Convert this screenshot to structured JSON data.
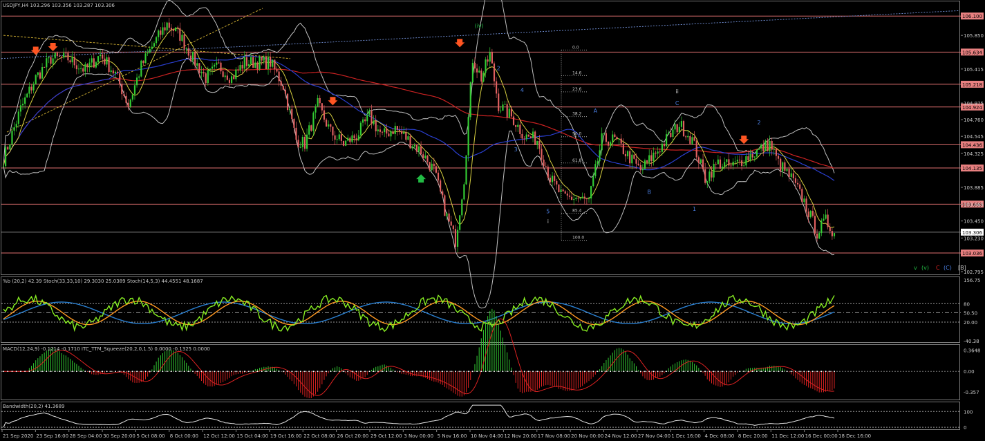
{
  "window": {
    "main_header": "USDJPY,H4  103.296 103.356 103.287 103.306",
    "osc_header": "%b (20,2) 42.39   Stoch(33,33,10) 29.3030 25.0389   Stoch(14,5,3) 44.4551 48.1687",
    "macd_header": "MACD(12,24,9) -0.1214 -0.1710   ITC_TTM_Squeeze(20,2,0,1.5) 0.0000 -0.1325 0.0000",
    "bw_header": "Bandwidth(20,2) 41.3689"
  },
  "colors": {
    "background": "#000000",
    "level_line": "#e07070",
    "bull_candle": "#33cc33",
    "bear_candle": "#e06060",
    "ma_red": "#cc2222",
    "ma_blue": "#2a3fd0",
    "ma_yellow": "#d8d040",
    "bands": "#c0c0c0",
    "arrow_down": "#ff5522",
    "arrow_up": "#22bb44",
    "fib": "#a0a0a0",
    "stoch_orange": "#ff9922",
    "stoch_lime": "#88ee22",
    "pb_blue": "#2a7fd0",
    "macd_pos": "#33cc33",
    "macd_neg": "#dd2222",
    "macd_signal": "#dd2222"
  },
  "chart_data": {
    "type": "line",
    "symbol": "USDJPY",
    "timeframe": "H4",
    "price_axis": {
      "min": 102.795,
      "max": 106.2,
      "ticks": [
        "105.850",
        "105.415",
        "104.975",
        "104.760",
        "104.545",
        "104.325",
        "103.885",
        "103.665",
        "103.450",
        "103.230",
        "102.795"
      ],
      "tick_values": [
        105.85,
        105.415,
        104.975,
        104.76,
        104.545,
        104.325,
        103.885,
        103.665,
        103.45,
        103.23,
        102.795
      ]
    },
    "levels": [
      {
        "label": "106.100",
        "value": 106.1
      },
      {
        "label": "105.634",
        "value": 105.634
      },
      {
        "label": "105.218",
        "value": 105.218
      },
      {
        "label": "104.924",
        "value": 104.924
      },
      {
        "label": "104.436",
        "value": 104.436
      },
      {
        "label": "104.135",
        "value": 104.135
      },
      {
        "label": "103.668",
        "value": 103.668
      },
      {
        "label": "103.036",
        "value": 103.036
      }
    ],
    "current_price": {
      "label": "103.306",
      "value": 103.306
    },
    "time_labels": [
      "21 Sep 2020",
      "23 Sep 16:00",
      "28 Sep 04:00",
      "30 Sep 20:00",
      "5 Oct 08:00",
      "8 Oct 00:00",
      "12 Oct 12:00",
      "15 Oct 04:00",
      "19 Oct 16:00",
      "22 Oct 08:00",
      "26 Oct 20:00",
      "29 Oct 12:00",
      "3 Nov 00:00",
      "5 Nov 16:00",
      "10 Nov 04:00",
      "12 Nov 20:00",
      "17 Nov 08:00",
      "20 Nov 00:00",
      "24 Nov 12:00",
      "27 Nov 04:00",
      "1 Dec 16:00",
      "4 Dec 08:00",
      "8 Dec 20:00",
      "11 Dec 12:00",
      "16 Dec 00:00",
      "18 Dec 16:00"
    ],
    "close_path": [
      [
        0,
        104.25
      ],
      [
        8,
        104.9
      ],
      [
        15,
        105.3
      ],
      [
        22,
        105.55
      ],
      [
        30,
        105.55
      ],
      [
        38,
        105.4
      ],
      [
        45,
        105.6
      ],
      [
        52,
        105.35
      ],
      [
        58,
        104.95
      ],
      [
        64,
        105.45
      ],
      [
        70,
        105.75
      ],
      [
        76,
        106.0
      ],
      [
        82,
        105.85
      ],
      [
        88,
        105.55
      ],
      [
        94,
        105.3
      ],
      [
        100,
        105.45
      ],
      [
        106,
        105.3
      ],
      [
        112,
        105.5
      ],
      [
        118,
        105.5
      ],
      [
        124,
        105.5
      ],
      [
        130,
        105.2
      ],
      [
        136,
        104.5
      ],
      [
        140,
        104.45
      ],
      [
        146,
        104.95
      ],
      [
        152,
        104.6
      ],
      [
        158,
        104.45
      ],
      [
        164,
        104.55
      ],
      [
        170,
        104.8
      ],
      [
        176,
        104.55
      ],
      [
        182,
        104.65
      ],
      [
        188,
        104.5
      ],
      [
        194,
        104.35
      ],
      [
        200,
        104.1
      ],
      [
        206,
        103.5
      ],
      [
        210,
        103.2
      ],
      [
        214,
        104.0
      ],
      [
        218,
        105.55
      ],
      [
        222,
        105.3
      ],
      [
        226,
        105.6
      ],
      [
        230,
        104.95
      ],
      [
        236,
        104.8
      ],
      [
        242,
        104.55
      ],
      [
        248,
        104.5
      ],
      [
        254,
        104.0
      ],
      [
        260,
        103.75
      ],
      [
        266,
        103.75
      ],
      [
        272,
        103.7
      ],
      [
        278,
        104.5
      ],
      [
        284,
        104.5
      ],
      [
        290,
        104.3
      ],
      [
        296,
        104.1
      ],
      [
        302,
        104.3
      ],
      [
        308,
        104.5
      ],
      [
        314,
        104.7
      ],
      [
        320,
        104.5
      ],
      [
        326,
        104.0
      ],
      [
        332,
        104.2
      ],
      [
        338,
        104.15
      ],
      [
        344,
        104.25
      ],
      [
        350,
        104.35
      ],
      [
        356,
        104.45
      ],
      [
        360,
        104.2
      ],
      [
        366,
        104.0
      ],
      [
        372,
        103.7
      ],
      [
        378,
        103.3
      ],
      [
        382,
        103.45
      ],
      [
        386,
        103.3
      ]
    ],
    "close_path_note_units": [
      "bar index",
      "price"
    ],
    "fibonacci": [
      {
        "label": "0.0",
        "value": 105.66
      },
      {
        "label": "14.6",
        "value": 105.33
      },
      {
        "label": "23.6",
        "value": 105.12
      },
      {
        "label": "38.2",
        "value": 104.8
      },
      {
        "label": "50.0",
        "value": 104.54
      },
      {
        "label": "61.8",
        "value": 104.2
      },
      {
        "label": "85.4",
        "value": 103.55
      },
      {
        "label": "100.0",
        "value": 103.2
      }
    ],
    "wave_labels": [
      {
        "text": "(iv)",
        "bar": 221,
        "price": 105.95,
        "color": "#22bb44"
      },
      {
        "text": "2",
        "bar": 230,
        "price": 105.4,
        "color": "#4a7ee0"
      },
      {
        "text": "4",
        "bar": 241,
        "price": 105.12,
        "color": "#4a7ee0"
      },
      {
        "text": "3",
        "bar": 238,
        "price": 104.35,
        "color": "#4a7ee0"
      },
      {
        "text": "5",
        "bar": 253,
        "price": 103.55,
        "color": "#4a7ee0"
      },
      {
        "text": "i",
        "bar": 253,
        "price": 103.42,
        "color": "#c8c8c8"
      },
      {
        "text": "A",
        "bar": 275,
        "price": 104.85,
        "color": "#4a7ee0"
      },
      {
        "text": "B",
        "bar": 300,
        "price": 103.8,
        "color": "#4a7ee0"
      },
      {
        "text": "C",
        "bar": 313,
        "price": 104.95,
        "color": "#4a7ee0"
      },
      {
        "text": "ii",
        "bar": 313,
        "price": 105.1,
        "color": "#c8c8c8"
      },
      {
        "text": "1",
        "bar": 321,
        "price": 103.58,
        "color": "#4a7ee0"
      },
      {
        "text": "2",
        "bar": 351,
        "price": 104.7,
        "color": "#4a7ee0"
      }
    ],
    "arrows_down": [
      [
        15,
        105.65
      ],
      [
        23,
        105.7
      ],
      [
        153,
        105.0
      ],
      [
        212,
        105.75
      ],
      [
        344,
        104.5
      ]
    ],
    "arrows_up": [
      [
        194,
        104.0
      ]
    ],
    "legend_tags": [
      "v",
      "(v)",
      "C",
      "(C)",
      "[B]"
    ],
    "oscillator_axis": {
      "ticks": [
        "156.75",
        "80",
        "50.50",
        "20.00",
        "-40.38"
      ],
      "tick_values": [
        156.75,
        80,
        50.5,
        20,
        -40.38
      ],
      "min": -40.38,
      "max": 156.75
    },
    "macd_axis": {
      "ticks": [
        "0.3648",
        "0.00",
        "-0.357"
      ],
      "tick_values": [
        0.3648,
        0,
        -0.357
      ],
      "min": -0.45,
      "max": 0.42
    },
    "bandwidth_axis": {
      "ticks": [
        "100",
        "0"
      ],
      "tick_values": [
        100,
        0
      ],
      "min": -8,
      "max": 145
    }
  }
}
